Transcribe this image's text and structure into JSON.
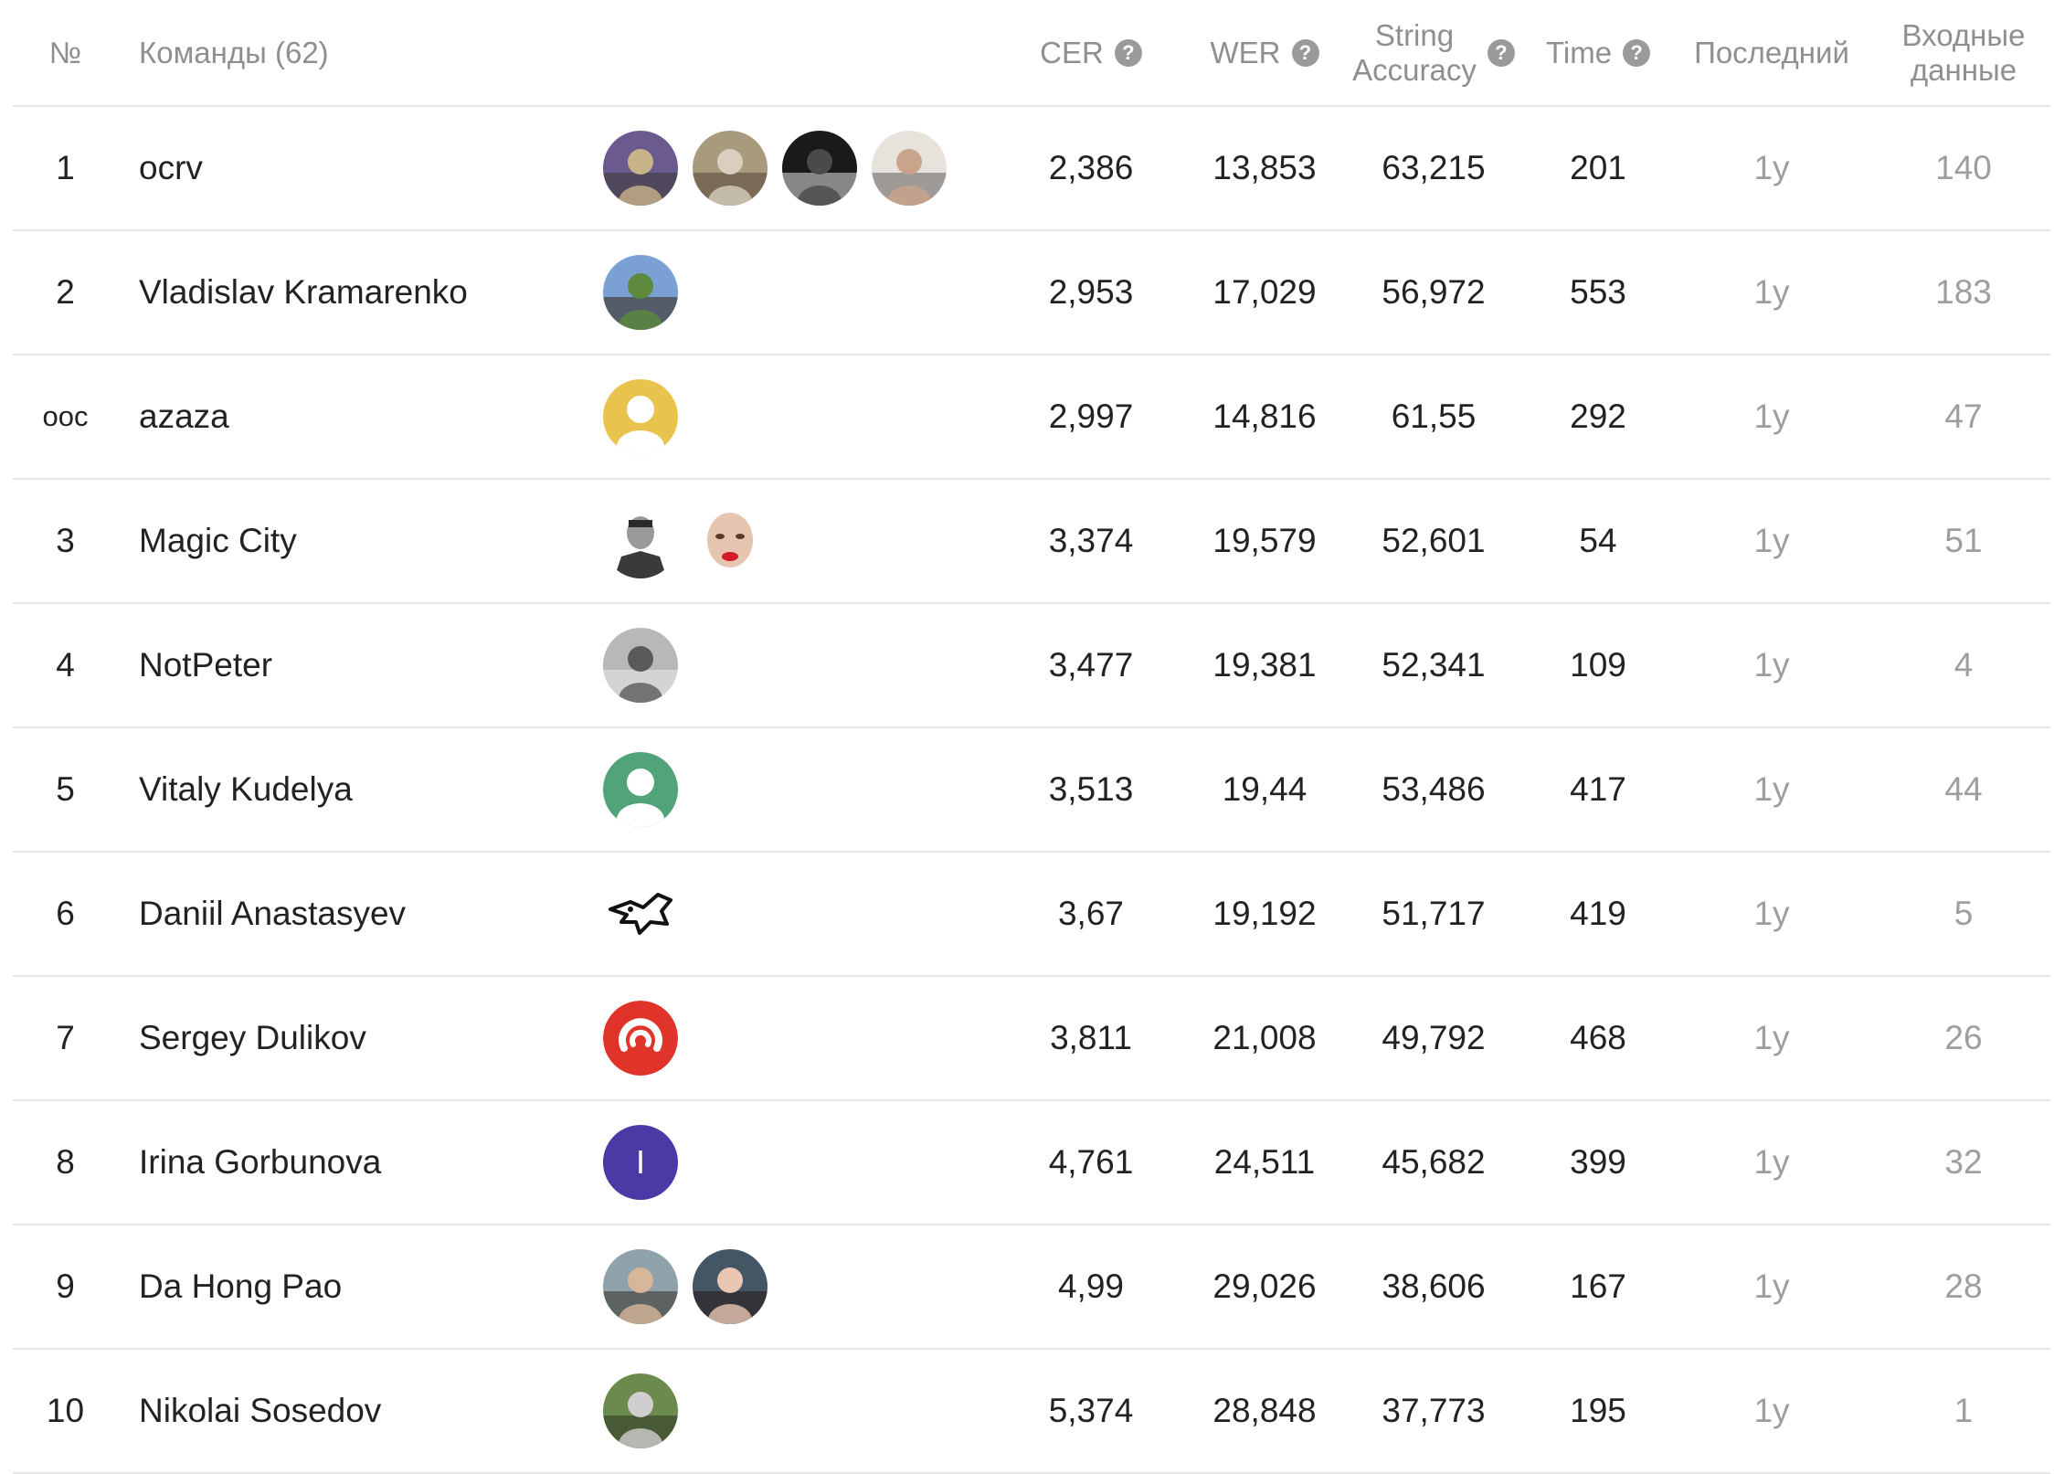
{
  "header": {
    "rank": "№",
    "teams": "Команды (62)",
    "cer": "CER",
    "wer": "WER",
    "accuracy_line1": "String",
    "accuracy_line2": "Accuracy",
    "time": "Time",
    "last": "Последний",
    "input_line1": "Входные",
    "input_line2": "данные",
    "help_glyph": "?"
  },
  "rows": [
    {
      "rank": "1",
      "team": "ocrv",
      "avatars": [
        "photo-icon",
        "photo-icon",
        "photo-icon",
        "photo-icon"
      ],
      "cer": "2,386",
      "wer": "13,853",
      "accuracy": "63,215",
      "time": "201",
      "last": "1y",
      "input": "140"
    },
    {
      "rank": "2",
      "team": "Vladislav Kramarenko",
      "avatars": [
        "photo-icon"
      ],
      "cer": "2,953",
      "wer": "17,029",
      "accuracy": "56,972",
      "time": "553",
      "last": "1y",
      "input": "183"
    },
    {
      "rank": "ooc",
      "team": "azaza",
      "avatars": [
        "default-user-icon"
      ],
      "avatar_color": "#e8c44e",
      "cer": "2,997",
      "wer": "14,816",
      "accuracy": "61,55",
      "time": "292",
      "last": "1y",
      "input": "47"
    },
    {
      "rank": "3",
      "team": "Magic City",
      "avatars": [
        "portrait-icon",
        "clown-face-icon"
      ],
      "cer": "3,374",
      "wer": "19,579",
      "accuracy": "52,601",
      "time": "54",
      "last": "1y",
      "input": "51"
    },
    {
      "rank": "4",
      "team": "NotPeter",
      "avatars": [
        "photo-icon"
      ],
      "cer": "3,477",
      "wer": "19,381",
      "accuracy": "52,341",
      "time": "109",
      "last": "1y",
      "input": "4"
    },
    {
      "rank": "5",
      "team": "Vitaly Kudelya",
      "avatars": [
        "default-user-icon"
      ],
      "avatar_color": "#52a27a",
      "cer": "3,513",
      "wer": "19,44",
      "accuracy": "53,486",
      "time": "417",
      "last": "1y",
      "input": "44"
    },
    {
      "rank": "6",
      "team": "Daniil Anastasyev",
      "avatars": [
        "bird-icon"
      ],
      "cer": "3,67",
      "wer": "19,192",
      "accuracy": "51,717",
      "time": "419",
      "last": "1y",
      "input": "5"
    },
    {
      "rank": "7",
      "team": "Sergey Dulikov",
      "avatars": [
        "red-logo-icon"
      ],
      "cer": "3,811",
      "wer": "21,008",
      "accuracy": "49,792",
      "time": "468",
      "last": "1y",
      "input": "26"
    },
    {
      "rank": "8",
      "team": "Irina Gorbunova",
      "avatars": [
        "letter-avatar"
      ],
      "avatar_letter": "I",
      "avatar_color": "#4a3aa6",
      "cer": "4,761",
      "wer": "24,511",
      "accuracy": "45,682",
      "time": "399",
      "last": "1y",
      "input": "32"
    },
    {
      "rank": "9",
      "team": "Da Hong Pao",
      "avatars": [
        "photo-icon",
        "photo-icon"
      ],
      "cer": "4,99",
      "wer": "29,026",
      "accuracy": "38,606",
      "time": "167",
      "last": "1y",
      "input": "28"
    },
    {
      "rank": "10",
      "team": "Nikolai Sosedov",
      "avatars": [
        "photo-icon"
      ],
      "cer": "5,374",
      "wer": "28,848",
      "accuracy": "37,773",
      "time": "195",
      "last": "1y",
      "input": "1"
    }
  ]
}
